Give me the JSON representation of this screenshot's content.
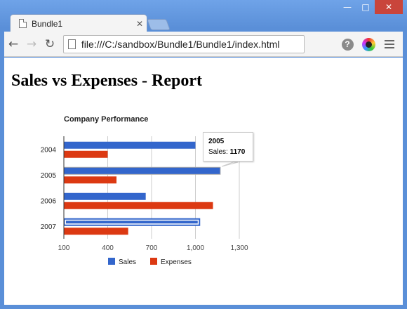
{
  "browser": {
    "tab_title": "Bundle1",
    "url": "file:///C:/sandbox/Bundle1/Bundle1/index.html"
  },
  "page": {
    "heading": "Sales vs Expenses - Report"
  },
  "tooltip": {
    "year": "2005",
    "label": "Sales: ",
    "value": "1170"
  },
  "chart_data": {
    "type": "bar",
    "orientation": "horizontal",
    "title": "Company Performance",
    "categories": [
      "2004",
      "2005",
      "2006",
      "2007"
    ],
    "series": [
      {
        "name": "Sales",
        "values": [
          1000,
          1170,
          660,
          1030
        ],
        "color": "#3366cc"
      },
      {
        "name": "Expenses",
        "values": [
          400,
          460,
          1120,
          540
        ],
        "color": "#dc3912"
      }
    ],
    "xticks": [
      "100",
      "400",
      "700",
      "1,000",
      "1,300"
    ],
    "xlim": [
      100,
      1300
    ],
    "grid": true,
    "legend": "bottom",
    "highlighted": {
      "series": "Sales",
      "category": "2007"
    }
  }
}
